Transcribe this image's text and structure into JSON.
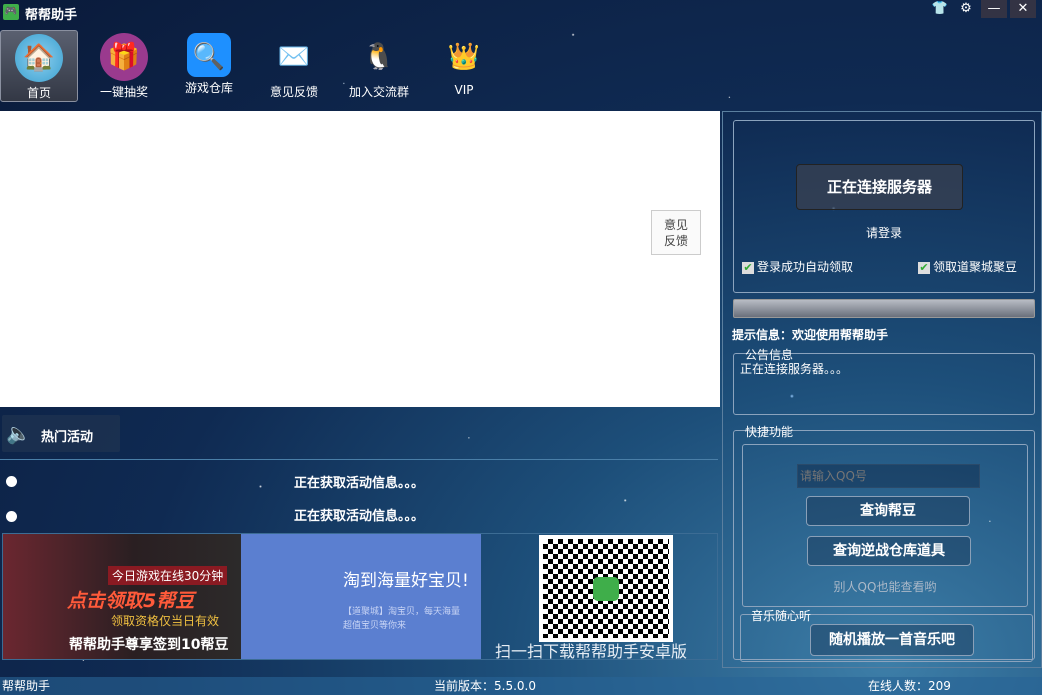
{
  "window": {
    "title": "帮帮助手",
    "controls": [
      "skin",
      "settings",
      "minimize",
      "close"
    ],
    "app_icon": "gamepad"
  },
  "nav": [
    {
      "label": "首页",
      "icon": "home",
      "selected": true
    },
    {
      "label": "一键抽奖",
      "icon": "gift"
    },
    {
      "label": "游戏仓库",
      "icon": "search"
    },
    {
      "label": "意见反馈",
      "icon": "envelope"
    },
    {
      "label": "加入交流群",
      "icon": "penguin"
    },
    {
      "label": "VIP",
      "icon": "crown"
    }
  ],
  "content": {
    "feedback_line1": "意见",
    "feedback_line2": "反馈"
  },
  "hot": {
    "title": "热门活动",
    "rows": [
      "正在获取活动信息。。。",
      "正在获取活动信息。。。"
    ]
  },
  "banners": {
    "ad1": {
      "line1": "今日游戏在线30分钟",
      "line2": "点击领取5帮豆",
      "line3": "领取资格仅当日有效",
      "caption": "帮帮助手尊享签到10帮豆"
    },
    "ad2": {
      "headline": "淘到海量好宝贝!",
      "line1": "【道聚城】淘宝贝，每天海量",
      "line2": "超值宝贝等你来"
    },
    "qr": {
      "caption": "扫一扫下载帮帮助手安卓版"
    }
  },
  "login": {
    "button": "正在连接服务器",
    "prompt": "请登录",
    "check1": "登录成功自动领取",
    "check2": "领取道聚城聚豆",
    "check1_checked": true,
    "check2_checked": true,
    "progress": 0
  },
  "tip": "提示信息：欢迎使用帮帮助手",
  "notice": {
    "legend": "公告信息",
    "text": "正在连接服务器。。。"
  },
  "quick": {
    "legend": "快捷功能",
    "qq_placeholder": "请输入QQ号",
    "btn1": "查询帮豆",
    "btn2": "查询逆战仓库道具",
    "hint": "别人QQ也能查看哟"
  },
  "music": {
    "legend": "音乐随心听",
    "button": "随机播放一首音乐吧"
  },
  "status": {
    "app": "帮帮助手",
    "version_label": "当前版本：",
    "version": "5.5.0.0",
    "online_label": "在线人数：",
    "online": "209"
  },
  "colors": {
    "accent": "#3fae4a",
    "panel": "#0f2a52"
  }
}
